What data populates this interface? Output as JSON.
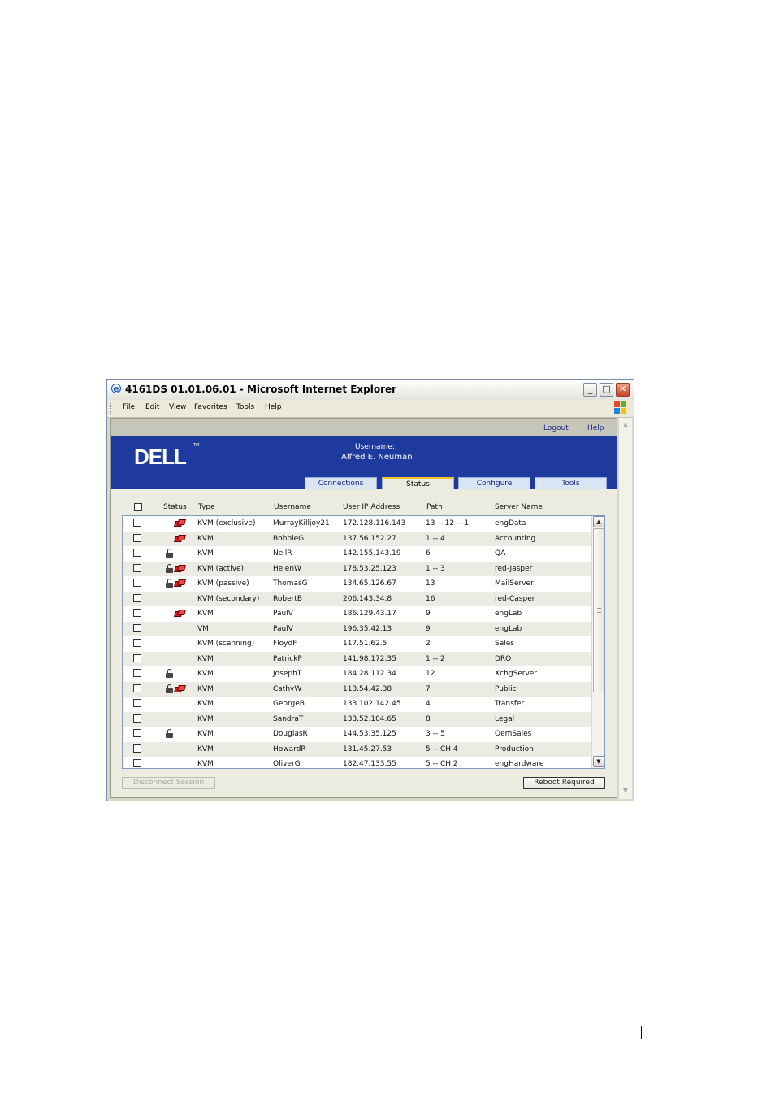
{
  "window": {
    "title": "4161DS 01.01.06.01 - Microsoft Internet Explorer",
    "ie_icon": "e",
    "minimize": "_",
    "maximize": "□",
    "close": "✕"
  },
  "menu": {
    "items": [
      "File",
      "Edit",
      "View",
      "Favorites",
      "Tools",
      "Help"
    ]
  },
  "header": {
    "logout": "Logout",
    "help": "Help",
    "logo": "DELL",
    "logo_tm": "TM",
    "username_label": "Username:",
    "username_value": "Alfred E. Neuman"
  },
  "tabs": [
    {
      "label": "Connections",
      "active": false
    },
    {
      "label": "Status",
      "active": true
    },
    {
      "label": "Configure",
      "active": false
    },
    {
      "label": "Tools",
      "active": false
    }
  ],
  "table": {
    "columns": [
      "Status",
      "Type",
      "Username",
      "User IP Address",
      "Path",
      "Server Name"
    ],
    "rows": [
      {
        "lock": false,
        "session": true,
        "type": "KVM (exclusive)",
        "username": "MurrayKilljoy21",
        "ip": "172.128.116.143",
        "path": "13 -- 12 -- 1",
        "server": "engData"
      },
      {
        "lock": false,
        "session": true,
        "type": "KVM",
        "username": "BobbieG",
        "ip": "137.56.152.27",
        "path": "1 -- 4",
        "server": "Accounting"
      },
      {
        "lock": true,
        "session": false,
        "type": "KVM",
        "username": "NeilR",
        "ip": "142.155.143.19",
        "path": "6",
        "server": "QA"
      },
      {
        "lock": true,
        "session": true,
        "type": "KVM (active)",
        "username": "HelenW",
        "ip": "178.53.25.123",
        "path": "1 -- 3",
        "server": "red-Jasper"
      },
      {
        "lock": true,
        "session": true,
        "type": "KVM (passive)",
        "username": "ThomasG",
        "ip": "134.65.126.67",
        "path": "13",
        "server": "MailServer"
      },
      {
        "lock": false,
        "session": false,
        "type": "KVM (secondary)",
        "username": "RobertB",
        "ip": "206.143.34.8",
        "path": "16",
        "server": "red-Casper"
      },
      {
        "lock": false,
        "session": true,
        "type": "KVM",
        "username": "PaulV",
        "ip": "186.129.43.17",
        "path": "9",
        "server": "engLab"
      },
      {
        "lock": false,
        "session": false,
        "type": "VM",
        "username": "PaulV",
        "ip": "196.35.42.13",
        "path": "9",
        "server": "engLab"
      },
      {
        "lock": false,
        "session": false,
        "type": "KVM (scanning)",
        "username": "FloydF",
        "ip": "117.51.62.5",
        "path": "2",
        "server": "Sales"
      },
      {
        "lock": false,
        "session": false,
        "type": "KVM",
        "username": "PatrickP",
        "ip": "141.98.172.35",
        "path": "1 -- 2",
        "server": "DRO"
      },
      {
        "lock": true,
        "session": false,
        "type": "KVM",
        "username": "JosephT",
        "ip": "184.28.112.34",
        "path": "12",
        "server": "XchgServer"
      },
      {
        "lock": true,
        "session": true,
        "type": "KVM",
        "username": "CathyW",
        "ip": "113.54.42.38",
        "path": "7",
        "server": "Public"
      },
      {
        "lock": false,
        "session": false,
        "type": "KVM",
        "username": "GeorgeB",
        "ip": "133.102.142.45",
        "path": "4",
        "server": "Transfer"
      },
      {
        "lock": false,
        "session": false,
        "type": "KVM",
        "username": "SandraT",
        "ip": "133.52.104.65",
        "path": "8",
        "server": "Legal"
      },
      {
        "lock": true,
        "session": false,
        "type": "KVM",
        "username": "DouglasR",
        "ip": "144.53.35.125",
        "path": "3 -- 5",
        "server": "OemSales"
      },
      {
        "lock": false,
        "session": false,
        "type": "KVM",
        "username": "HowardR",
        "ip": "131.45.27.53",
        "path": "5 -- CH 4",
        "server": "Production"
      },
      {
        "lock": false,
        "session": false,
        "type": "KVM",
        "username": "OliverG",
        "ip": "182.47.133.55",
        "path": "5 -- CH 2",
        "server": "engHardware"
      }
    ]
  },
  "buttons": {
    "disconnect": "Disconnect Session",
    "reboot": "Reboot Required"
  }
}
